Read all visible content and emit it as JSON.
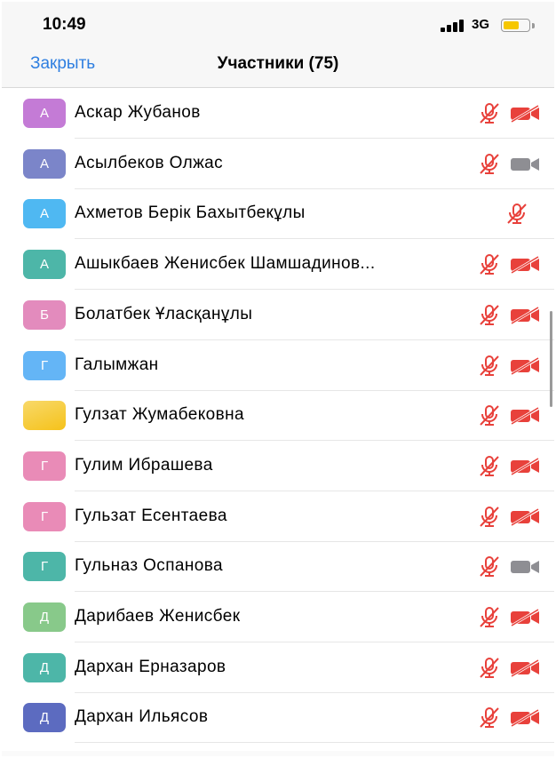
{
  "status_bar": {
    "time": "10:49",
    "network": "3G",
    "battery_level": 0.65,
    "battery_color": "#f6c700"
  },
  "nav": {
    "close_label": "Закрыть",
    "title": "Участники (75)"
  },
  "colors": {
    "accent": "#2f7fe0",
    "muted_red": "#e8413b",
    "camera_gray": "#8e8e93"
  },
  "participants": [
    {
      "initial": "А",
      "name": "Аскар Жубанов",
      "avatar_color": "#c47bd6",
      "mic": "muted",
      "video": "off"
    },
    {
      "initial": "А",
      "name": "Асылбеков Олжас",
      "avatar_color": "#7b85c9",
      "mic": "muted",
      "video": "on"
    },
    {
      "initial": "А",
      "name": "Ахметов Берік Бахытбекұлы",
      "avatar_color": "#4fb8f2",
      "mic": "muted",
      "video": "none"
    },
    {
      "initial": "А",
      "name": "Ашыкбаев Женисбек Шамшадинов...",
      "avatar_color": "#4db6a8",
      "mic": "muted",
      "video": "off"
    },
    {
      "initial": "Б",
      "name": "Болатбек Ұласқанұлы",
      "avatar_color": "#e38bbd",
      "mic": "muted",
      "video": "off"
    },
    {
      "initial": "Г",
      "name": "Галымжан",
      "avatar_color": "#64b5f6",
      "mic": "muted",
      "video": "off"
    },
    {
      "initial": "",
      "name": "Гулзат Жумабековна",
      "avatar_color": "#f9cf2c",
      "mic": "muted",
      "video": "off"
    },
    {
      "initial": "Г",
      "name": "Гулим Ибрашева",
      "avatar_color": "#e98bb7",
      "mic": "muted",
      "video": "off"
    },
    {
      "initial": "Г",
      "name": "Гульзат Есентаева",
      "avatar_color": "#e98bb7",
      "mic": "muted",
      "video": "off"
    },
    {
      "initial": "Г",
      "name": "Гульназ Оспанова",
      "avatar_color": "#4db6a8",
      "mic": "muted",
      "video": "on"
    },
    {
      "initial": "Д",
      "name": "Дарибаев Женисбек",
      "avatar_color": "#88c98a",
      "mic": "muted",
      "video": "off"
    },
    {
      "initial": "Д",
      "name": "Дархан Ерназаров",
      "avatar_color": "#4db6a8",
      "mic": "muted",
      "video": "off"
    },
    {
      "initial": "Д",
      "name": "Дархан Ильясов",
      "avatar_color": "#5c6bc0",
      "mic": "muted",
      "video": "off"
    }
  ]
}
